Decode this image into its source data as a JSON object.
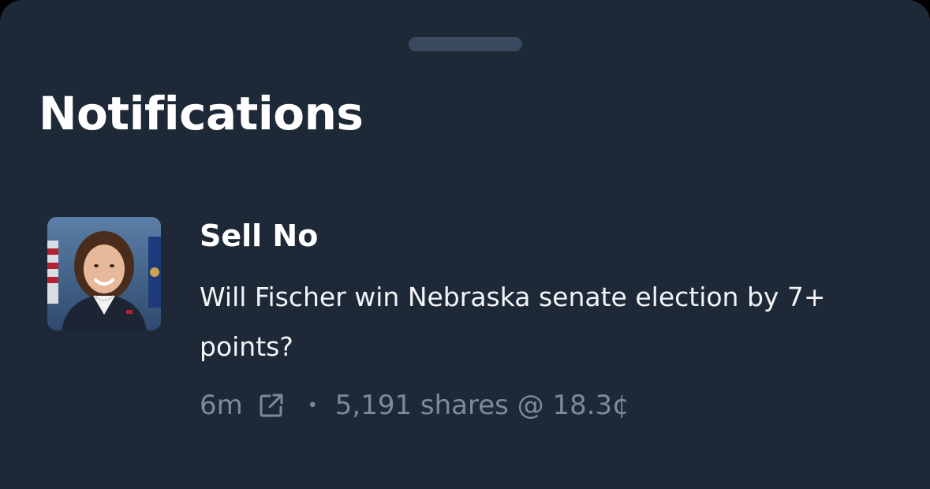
{
  "sheet": {
    "title": "Notifications"
  },
  "notifications": [
    {
      "type": "Sell No",
      "market": "Will Fischer win Nebraska senate election by 7+ points?",
      "time_ago": "6m",
      "separator": "•",
      "trade_summary": "5,191 shares @ 18.3¢",
      "avatar_icon": "person-portrait",
      "link_icon": "external-link-icon"
    }
  ],
  "colors": {
    "background": "#1e2938",
    "text_primary": "#ffffff",
    "text_muted": "#7f8a99",
    "handle": "#3a4a5e"
  }
}
